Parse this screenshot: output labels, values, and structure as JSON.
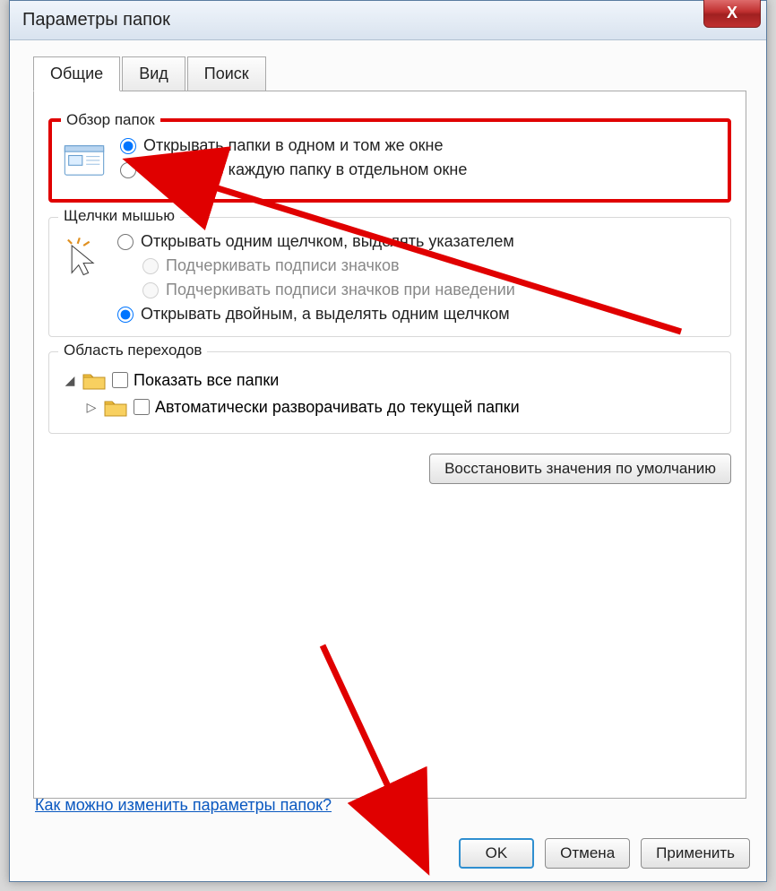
{
  "window": {
    "title": "Параметры папок",
    "close_x": "X"
  },
  "tabs": {
    "general": "Общие",
    "view": "Вид",
    "search": "Поиск"
  },
  "browse": {
    "legend": "Обзор папок",
    "opt_same": "Открывать папки в одном и том же окне",
    "opt_new": "Открывать каждую папку в отдельном окне"
  },
  "clicks": {
    "legend": "Щелчки мышью",
    "single": "Открывать одним щелчком, выделять указателем",
    "underline_always": "Подчеркивать подписи значков",
    "underline_hover": "Подчеркивать подписи значков при наведении",
    "double": "Открывать двойным, а выделять одним щелчком"
  },
  "navpane": {
    "legend": "Область переходов",
    "show_all": "Показать все папки",
    "auto_expand": "Автоматически разворачивать до текущей папки"
  },
  "restore_defaults": "Восстановить значения по умолчанию",
  "help_link": "Как можно изменить параметры папок?",
  "buttons": {
    "ok": "OK",
    "cancel": "Отмена",
    "apply": "Применить"
  }
}
